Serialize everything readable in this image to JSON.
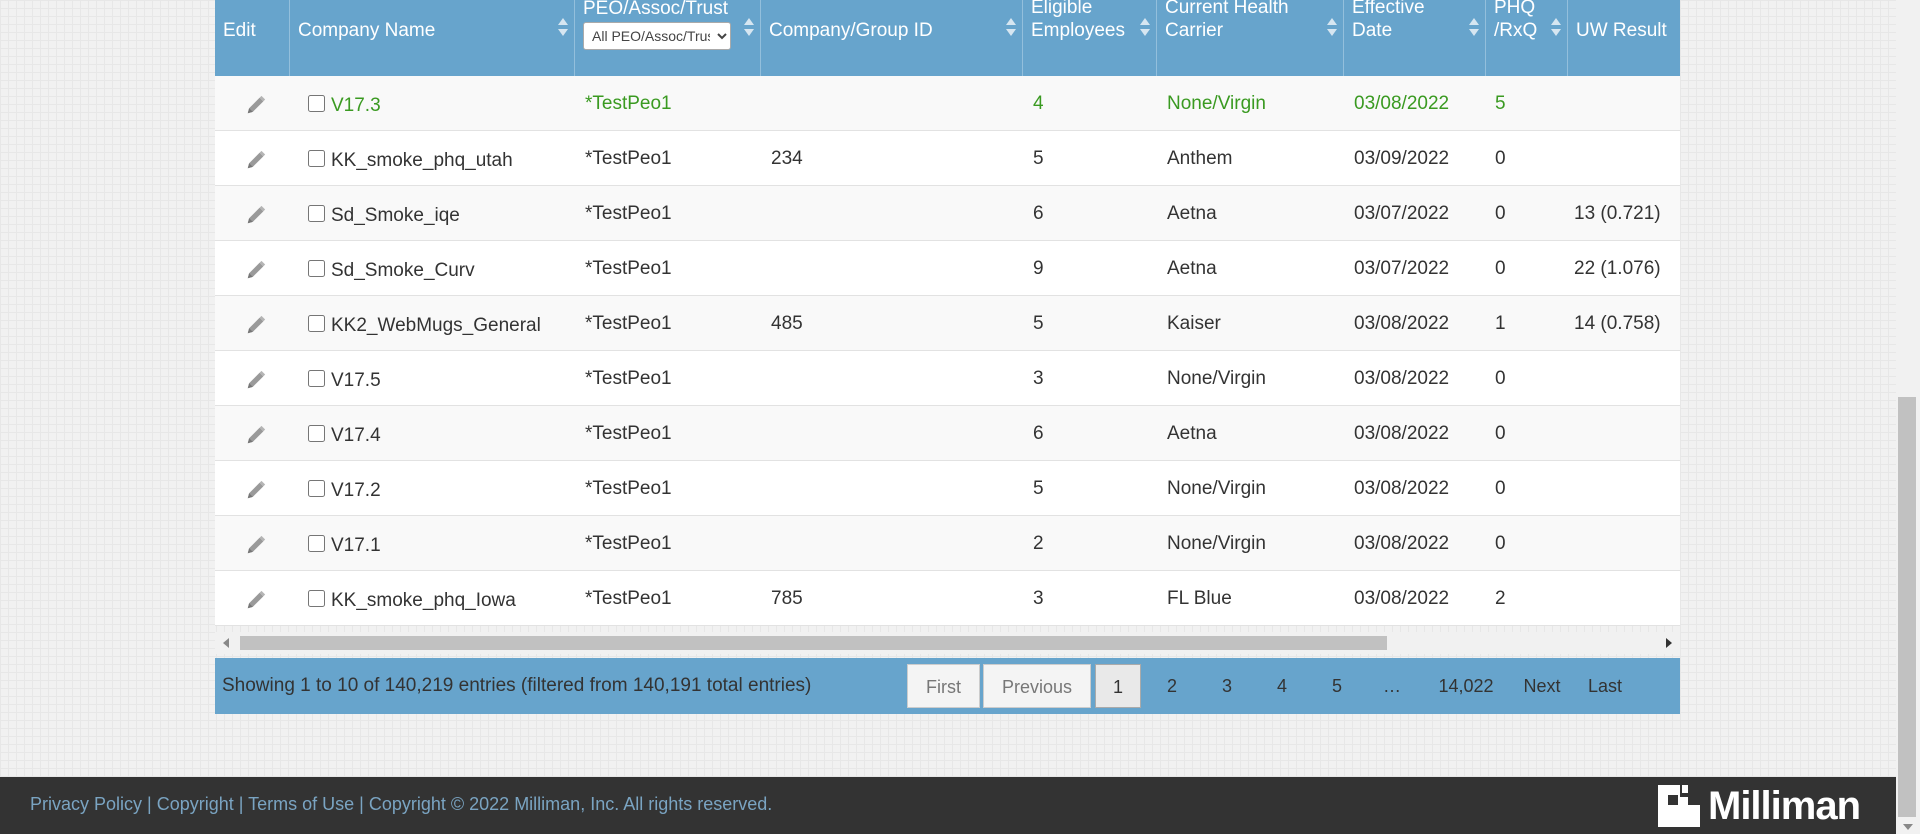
{
  "table": {
    "headers": {
      "edit": "Edit",
      "company_name": "Company Name",
      "peo": "PEO/Assoc/Trust",
      "group_id": "Company/Group ID",
      "eligible": "Eligible\nEmployees",
      "carrier": "Current Health\nCarrier",
      "effective": "Effective\nDate",
      "phq": "PHQ\n/RxQ",
      "uw": "UW Result"
    },
    "peo_filter": {
      "selected": "All PEO/Assoc/Trust"
    },
    "rows": [
      {
        "name": "V17.3",
        "peo": "*TestPeo1",
        "group_id": "",
        "eligible": "4",
        "carrier": "None/Virgin",
        "effective": "03/08/2022",
        "phq": "5",
        "uw": "",
        "highlight": true
      },
      {
        "name": "KK_smoke_phq_utah",
        "peo": "*TestPeo1",
        "group_id": "234",
        "eligible": "5",
        "carrier": "Anthem",
        "effective": "03/09/2022",
        "phq": "0",
        "uw": ""
      },
      {
        "name": "Sd_Smoke_iqe",
        "peo": "*TestPeo1",
        "group_id": "",
        "eligible": "6",
        "carrier": "Aetna",
        "effective": "03/07/2022",
        "phq": "0",
        "uw": "13 (0.721)"
      },
      {
        "name": "Sd_Smoke_Curv",
        "peo": "*TestPeo1",
        "group_id": "",
        "eligible": "9",
        "carrier": "Aetna",
        "effective": "03/07/2022",
        "phq": "0",
        "uw": "22 (1.076)"
      },
      {
        "name": "KK2_WebMugs_General",
        "peo": "*TestPeo1",
        "group_id": "485",
        "eligible": "5",
        "carrier": "Kaiser",
        "effective": "03/08/2022",
        "phq": "1",
        "uw": "14 (0.758)"
      },
      {
        "name": "V17.5",
        "peo": "*TestPeo1",
        "group_id": "",
        "eligible": "3",
        "carrier": "None/Virgin",
        "effective": "03/08/2022",
        "phq": "0",
        "uw": ""
      },
      {
        "name": "V17.4",
        "peo": "*TestPeo1",
        "group_id": "",
        "eligible": "6",
        "carrier": "Aetna",
        "effective": "03/08/2022",
        "phq": "0",
        "uw": ""
      },
      {
        "name": "V17.2",
        "peo": "*TestPeo1",
        "group_id": "",
        "eligible": "5",
        "carrier": "None/Virgin",
        "effective": "03/08/2022",
        "phq": "0",
        "uw": ""
      },
      {
        "name": "V17.1",
        "peo": "*TestPeo1",
        "group_id": "",
        "eligible": "2",
        "carrier": "None/Virgin",
        "effective": "03/08/2022",
        "phq": "0",
        "uw": ""
      },
      {
        "name": "KK_smoke_phq_Iowa",
        "peo": "*TestPeo1",
        "group_id": "785",
        "eligible": "3",
        "carrier": "FL Blue",
        "effective": "03/08/2022",
        "phq": "2",
        "uw": ""
      }
    ]
  },
  "pagination": {
    "info": "Showing 1 to 10 of 140,219 entries (filtered from 140,191 total entries)",
    "first": "First",
    "previous": "Previous",
    "pages": [
      "1",
      "2",
      "3",
      "4",
      "5"
    ],
    "ellipsis": "…",
    "last_page": "14,022",
    "next": "Next",
    "last": "Last",
    "current": "1"
  },
  "footer": {
    "privacy": "Privacy Policy",
    "copyright_link": "Copyright",
    "terms": "Terms of Use",
    "copyright_text": "Copyright © 2022 Milliman, Inc. All rights reserved.",
    "separator": " | ",
    "logo_text": "Milliman"
  },
  "colors": {
    "header_blue": "#67a4cc",
    "highlight_green": "#3a9a21",
    "footer_dark": "#333333",
    "link_blue": "#7aa4c2"
  },
  "icons": {
    "edit": "pencil-icon",
    "sort": "sort-both-icon",
    "dropdown": "chevron-down-icon",
    "logo": "milliman-logo-icon"
  }
}
